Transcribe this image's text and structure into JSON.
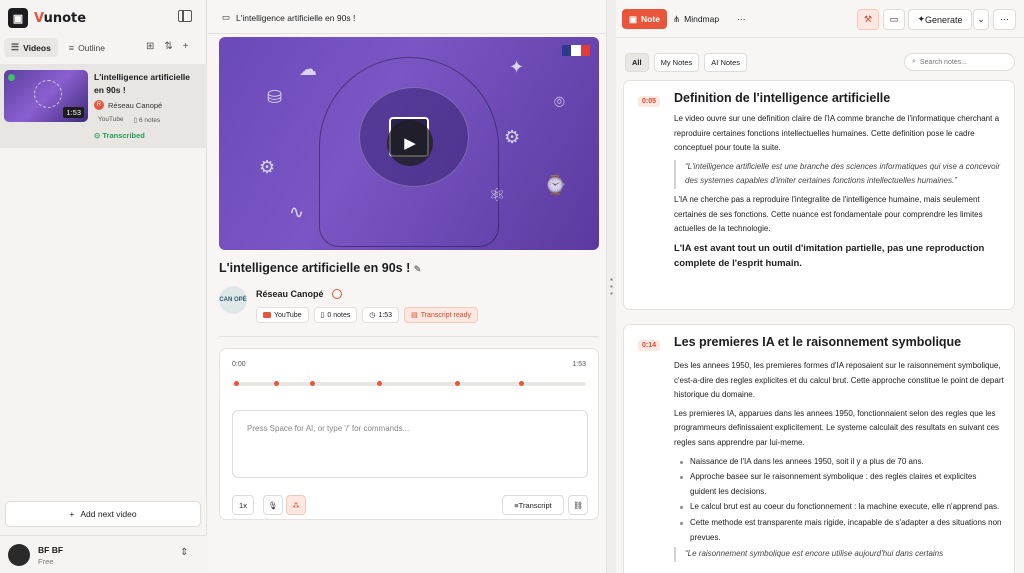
{
  "app": {
    "name_prefix": "V",
    "name_suffix": "unote"
  },
  "sidebar": {
    "tabs": [
      {
        "label": "Videos"
      },
      {
        "label": "Outline"
      }
    ],
    "video": {
      "title": "L'intelligence artificielle en 90s !",
      "duration": "1:53",
      "channel": "Réseau Canopé",
      "source": "YouTube",
      "notes": "6 notes",
      "status": "Transcribed"
    },
    "add_next": "Add next video",
    "user": {
      "name": "BF BF",
      "plan": "Free"
    }
  },
  "main": {
    "breadcrumb": "L'intelligence artificielle en 90s !",
    "video_title": "L'intelligence artificielle en 90s !",
    "channel": {
      "name": "Réseau Canopé",
      "logo_text": "CAN OPÉ"
    },
    "chips": {
      "source": "YouTube",
      "notes": "0 notes",
      "duration": "1:53",
      "transcript": "Transcript ready"
    },
    "player": {
      "time_start": "0:00",
      "time_end": "1:53",
      "marker_fractions": [
        0.005,
        0.12,
        0.22,
        0.41,
        0.63,
        0.81
      ],
      "editor_placeholder": "Press Space for AI, or type '/' for commands...",
      "speed": "1x",
      "transcript_btn": "Transcript"
    }
  },
  "right": {
    "top_tabs": [
      {
        "label": "Note"
      },
      {
        "label": "Mindmap"
      }
    ],
    "generate": "Generate",
    "filters": [
      "All",
      "My Notes",
      "AI Notes"
    ],
    "search_placeholder": "Search notes...",
    "notes": [
      {
        "time": "0:05",
        "title": "Definition de l'intelligence artificielle",
        "p1": "Le video ouvre sur une definition claire de l'IA comme branche de l'informatique cherchant a reproduire certaines fonctions intellectuelles humaines. Cette definition pose le cadre conceptuel pour toute la suite.",
        "quote": "“L'intelligence artificielle est une branche des sciences informatiques qui vise a concevoir des systemes capables d'imiter certaines fonctions intellectuelles humaines.”",
        "p2": "L'IA ne cherche pas a reproduire l'integralite de l'intelligence humaine, mais seulement certaines de ses fonctions. Cette nuance est fondamentale pour comprendre les limites actuelles de la technologie.",
        "bold": "L'IA est avant tout un outil d'imitation partielle, pas une reproduction complete de l'esprit humain."
      },
      {
        "time": "0:14",
        "title": "Les premieres IA et le raisonnement symbolique",
        "p1": "Des les annees 1950, les premieres formes d'IA reposaient sur le raisonnement symbolique, c'est-a-dire des regles explicites et du calcul brut. Cette approche constitue le point de depart historique du domaine.",
        "p2": "Les premieres IA, apparues dans les annees 1950, fonctionnaient selon des regles que les programmeurs definissaient explicitement. Le systeme calculait des resultats en suivant ces regles sans apprendre par lui-meme.",
        "bullets": [
          "Naissance de l'IA dans les annees 1950, soit il y a plus de 70 ans.",
          "Approche basee sur le raisonnement symbolique : des regles claires et explicites guident les decisions.",
          "Le calcul brut est au coeur du fonctionnement : la machine execute, elle n'apprend pas.",
          "Cette methode est transparente mais rigide, incapable de s'adapter a des situations non prevues."
        ],
        "quote": "“Le raisonnement symbolique est encore utilise aujourd'hui dans certains"
      }
    ]
  },
  "colors": {
    "accent": "#e8553a",
    "success": "#2a9d52",
    "video_bg": "#6a4ab8"
  },
  "icons": [
    "panel-collapse-icon",
    "folder-icon",
    "sort-icon",
    "plus-icon",
    "play-icon",
    "verified-icon",
    "note-icon",
    "clock-icon",
    "mic-icon",
    "ai-sparkle-icon",
    "link-icon",
    "magic-wand-icon",
    "present-icon",
    "chevron-down-icon",
    "more-icon",
    "search-icon"
  ]
}
